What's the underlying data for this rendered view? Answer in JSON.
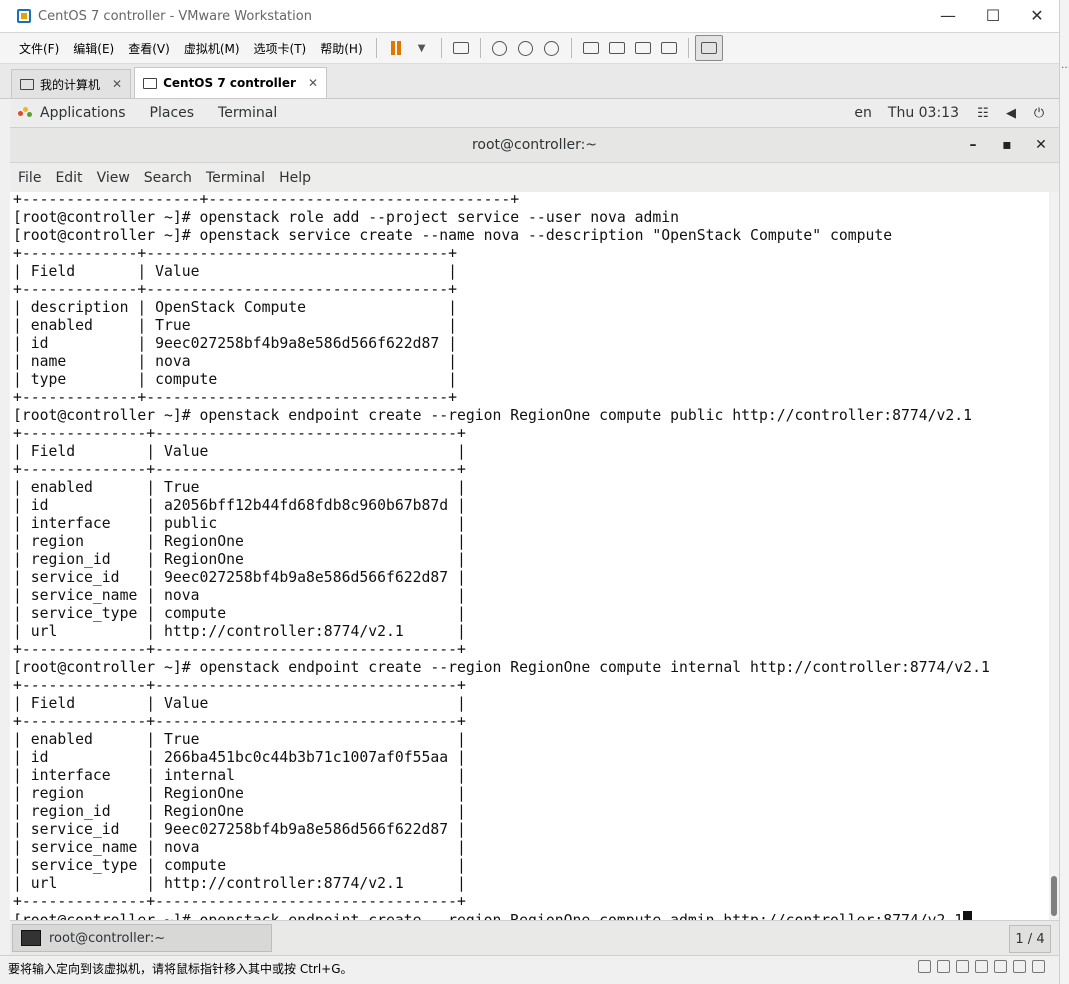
{
  "window": {
    "title": "CentOS 7 controller - VMware Workstation"
  },
  "vmware_menu": [
    "文件(F)",
    "编辑(E)",
    "查看(V)",
    "虚拟机(M)",
    "选项卡(T)",
    "帮助(H)"
  ],
  "vmware_tabs": [
    {
      "label": "我的计算机",
      "close": "✕"
    },
    {
      "label": "CentOS 7 controller",
      "close": "✕"
    }
  ],
  "gnome": {
    "applications": "Applications",
    "places": "Places",
    "terminal": "Terminal",
    "lang": "en",
    "clock": "Thu 03:13"
  },
  "terminal": {
    "title": "root@controller:~",
    "menu": [
      "File",
      "Edit",
      "View",
      "Search",
      "Terminal",
      "Help"
    ],
    "lines": [
      "+--------------------+----------------------------------+",
      "[root@controller ~]# openstack role add --project service --user nova admin",
      "[root@controller ~]# openstack service create --name nova --description \"OpenStack Compute\" compute",
      "+-------------+----------------------------------+",
      "| Field       | Value                            |",
      "+-------------+----------------------------------+",
      "| description | OpenStack Compute                |",
      "| enabled     | True                             |",
      "| id          | 9eec027258bf4b9a8e586d566f622d87 |",
      "| name        | nova                             |",
      "| type        | compute                          |",
      "+-------------+----------------------------------+",
      "[root@controller ~]# openstack endpoint create --region RegionOne compute public http://controller:8774/v2.1",
      "+--------------+----------------------------------+",
      "| Field        | Value                            |",
      "+--------------+----------------------------------+",
      "| enabled      | True                             |",
      "| id           | a2056bff12b44fd68fdb8c960b67b87d |",
      "| interface    | public                           |",
      "| region       | RegionOne                        |",
      "| region_id    | RegionOne                        |",
      "| service_id   | 9eec027258bf4b9a8e586d566f622d87 |",
      "| service_name | nova                             |",
      "| service_type | compute                          |",
      "| url          | http://controller:8774/v2.1      |",
      "+--------------+----------------------------------+",
      "[root@controller ~]# openstack endpoint create --region RegionOne compute internal http://controller:8774/v2.1",
      "+--------------+----------------------------------+",
      "| Field        | Value                            |",
      "+--------------+----------------------------------+",
      "| enabled      | True                             |",
      "| id           | 266ba451bc0c44b3b71c1007af0f55aa |",
      "| interface    | internal                         |",
      "| region       | RegionOne                        |",
      "| region_id    | RegionOne                        |",
      "| service_id   | 9eec027258bf4b9a8e586d566f622d87 |",
      "| service_name | nova                             |",
      "| service_type | compute                          |",
      "| url          | http://controller:8774/v2.1      |",
      "+--------------+----------------------------------+"
    ],
    "prompt_line": "[root@controller ~]# openstack endpoint create --region RegionOne compute admin http://controller:8774/v2.1"
  },
  "taskbar": {
    "item": "root@controller:~",
    "workspace": "1 / 4"
  },
  "statusbar": {
    "message": "要将输入定向到该虚拟机，请将鼠标指针移入其中或按 Ctrl+G。"
  },
  "colors": {
    "pause": "#e07800",
    "vmware_icon": "#1a6fb5",
    "terminal_bg": "#ffffff",
    "terminal_fg": "#111111"
  }
}
